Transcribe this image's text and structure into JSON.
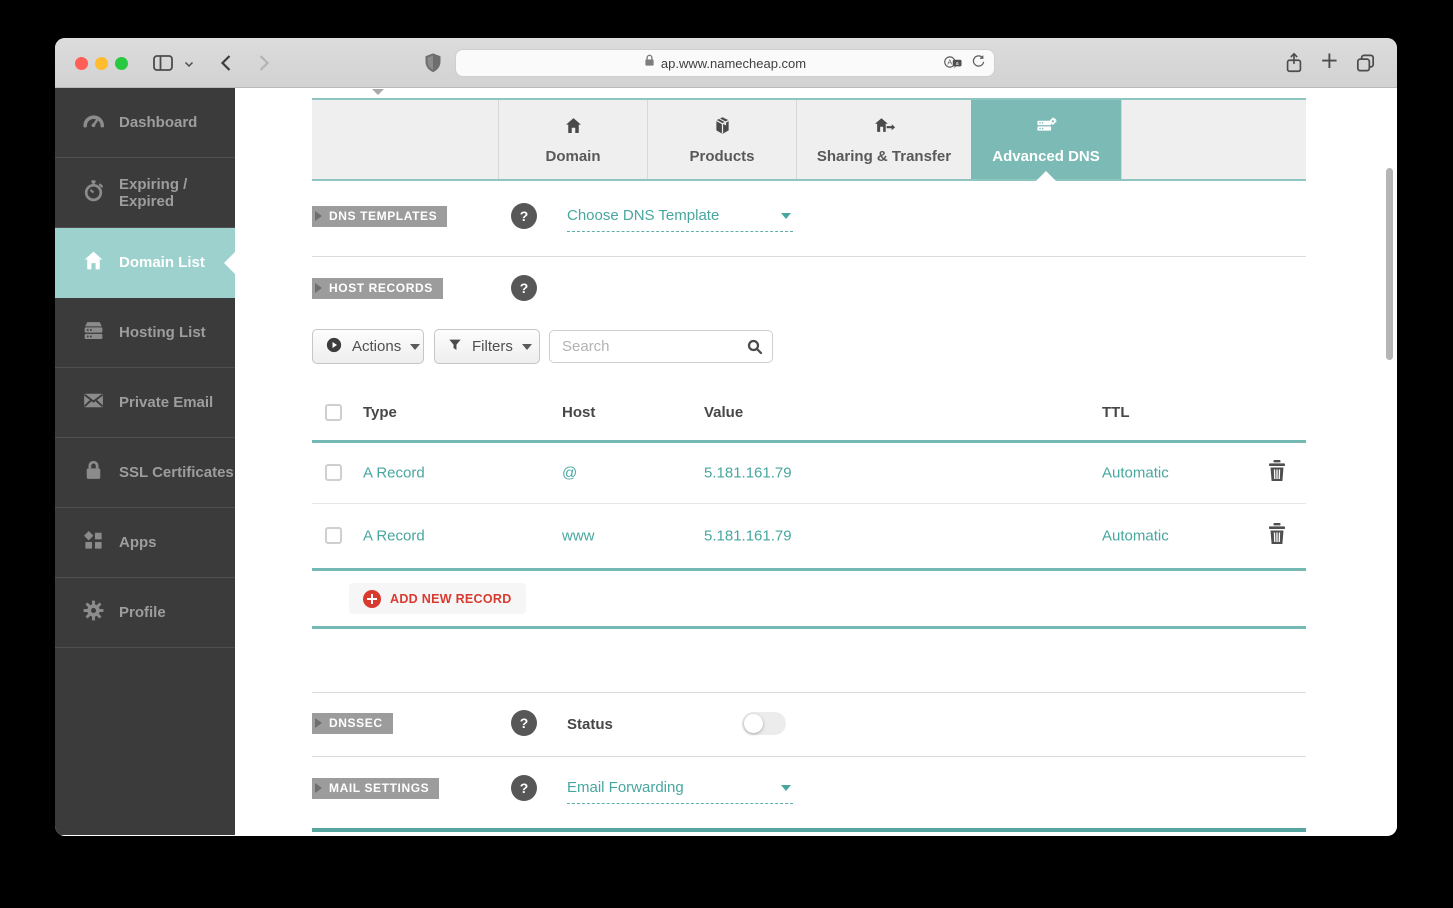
{
  "browser": {
    "url": "ap.www.namecheap.com",
    "lock_icon": "lock-icon",
    "toolbar_icons": [
      "sidebar-toggle-icon",
      "chevron-down-icon",
      "back-icon",
      "forward-icon",
      "shield-icon",
      "translate-icon",
      "reload-icon",
      "share-icon",
      "new-tab-plus-icon",
      "tab-overview-icon"
    ],
    "plus_label": "+",
    "traffic_lights": {
      "close": "#ff5f57",
      "minimize": "#febc2e",
      "zoom": "#28c840"
    }
  },
  "sidebar": {
    "items": [
      {
        "label": "Dashboard",
        "icon": "dashboard-gauge-icon",
        "selected": false
      },
      {
        "label": "Expiring / Expired",
        "icon": "stopwatch-icon",
        "selected": false
      },
      {
        "label": "Domain List",
        "icon": "home-icon",
        "selected": true
      },
      {
        "label": "Hosting List",
        "icon": "server-icon",
        "selected": false
      },
      {
        "label": "Private Email",
        "icon": "envelope-icon",
        "selected": false
      },
      {
        "label": "SSL Certificates",
        "icon": "padlock-icon",
        "selected": false
      },
      {
        "label": "Apps",
        "icon": "apps-grid-icon",
        "selected": false
      },
      {
        "label": "Profile",
        "icon": "gear-icon",
        "selected": false
      }
    ]
  },
  "tabs": [
    {
      "label": "Domain",
      "icon": "home-icon",
      "active": false
    },
    {
      "label": "Products",
      "icon": "package-icon",
      "active": false
    },
    {
      "label": "Sharing & Transfer",
      "icon": "house-arrow-icon",
      "active": false
    },
    {
      "label": "Advanced DNS",
      "icon": "server-gear-icon",
      "active": true
    }
  ],
  "dns_templates": {
    "badge": "DNS TEMPLATES",
    "help": "?",
    "dropdown_value": "Choose DNS Template"
  },
  "host_records": {
    "badge": "HOST RECORDS",
    "help": "?",
    "actions_label": "Actions",
    "filters_label": "Filters",
    "search_placeholder": "Search",
    "table": {
      "headers": [
        "Type",
        "Host",
        "Value",
        "TTL"
      ],
      "rows": [
        {
          "type": "A Record",
          "host": "@",
          "value": "5.181.161.79",
          "ttl": "Automatic"
        },
        {
          "type": "A Record",
          "host": "www",
          "value": "5.181.161.79",
          "ttl": "Automatic"
        }
      ]
    },
    "add_button": "ADD NEW RECORD"
  },
  "dnssec": {
    "badge": "DNSSEC",
    "help": "?",
    "status_label": "Status",
    "toggle_on": false
  },
  "mail_settings": {
    "badge": "MAIL SETTINGS",
    "help": "?",
    "dropdown_value": "Email Forwarding"
  },
  "colors": {
    "accent_teal": "#7cbab6",
    "teal_text": "#47a79f",
    "sidebar_selected": "#9cd1ce",
    "sidebar_bg": "#3b3b3b",
    "badge_gray": "#9c9c9c",
    "alert_red": "#d93a30"
  }
}
